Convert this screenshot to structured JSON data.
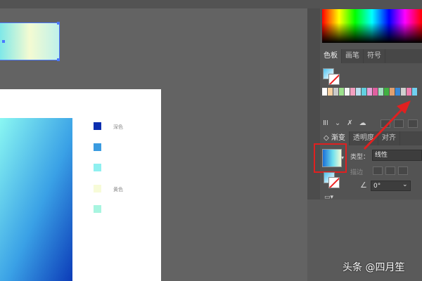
{
  "canvas": {
    "color_chips": [
      {
        "color": "#0c2fb0",
        "label": "深色"
      },
      {
        "color": "#3a9be0",
        "label": ""
      },
      {
        "color": "#8ff0f0",
        "label": ""
      },
      {
        "color": "#f7fbd8",
        "label": "黄色"
      },
      {
        "color": "#a8f5e0",
        "label": ""
      }
    ]
  },
  "panels": {
    "swatches_tabs": [
      "色板",
      "画笔",
      "符号"
    ],
    "gradient_tabs": [
      "渐变",
      "透明度",
      "对齐"
    ],
    "type_label": "类型：",
    "type_value": "线性",
    "stroke_label": "描边",
    "angle_value": "0°",
    "swatch_colors": [
      "#ffffff",
      "#f6d0a0",
      "#c9c9c9",
      "#9be08c",
      "#f6f6f6",
      "#f2a0c0",
      "#b8e0f0",
      "#60d0e0",
      "#e8a0d8",
      "#e060a0",
      "#a0e0c0",
      "#40b040",
      "#e0a070",
      "#3a8ad8",
      "#d0d0d0",
      "#f080b0",
      "#70d0f0"
    ]
  },
  "watermark": "头条 @四月笙"
}
